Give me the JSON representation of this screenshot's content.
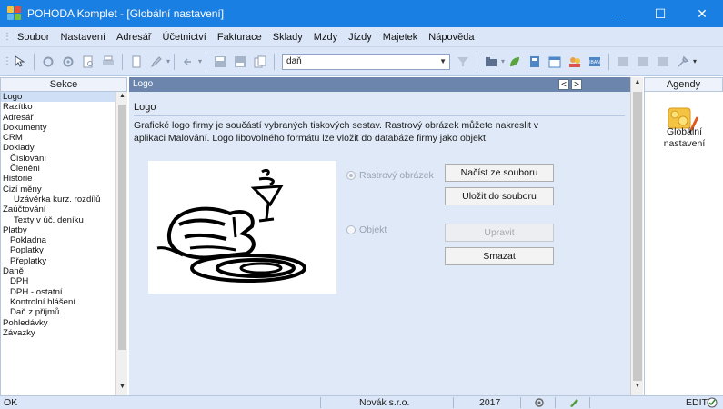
{
  "window": {
    "title": "POHODA Komplet - [Globální nastavení]",
    "minimize": "—",
    "maximize": "☐",
    "close": "✕"
  },
  "menu": {
    "items": [
      {
        "label": "Soubor"
      },
      {
        "label": "Nastavení"
      },
      {
        "label": "Adresář"
      },
      {
        "label": "Účetnictví"
      },
      {
        "label": "Fakturace"
      },
      {
        "label": "Sklady"
      },
      {
        "label": "Mzdy"
      },
      {
        "label": "Jízdy"
      },
      {
        "label": "Majetek"
      },
      {
        "label": "Nápověda"
      }
    ]
  },
  "toolbar": {
    "search_value": "daň"
  },
  "left_panel": {
    "header": "Sekce",
    "items": [
      {
        "label": "Logo",
        "level": 0,
        "selected": true
      },
      {
        "label": "Razítko",
        "level": 0
      },
      {
        "label": "Adresář",
        "level": 0
      },
      {
        "label": "Dokumenty",
        "level": 0
      },
      {
        "label": "CRM",
        "level": 0
      },
      {
        "label": "Doklady",
        "level": 0
      },
      {
        "label": "Číslování",
        "level": 1
      },
      {
        "label": "Členění",
        "level": 1
      },
      {
        "label": "Historie",
        "level": 0
      },
      {
        "label": "Cizí měny",
        "level": 0
      },
      {
        "label": "Uzávěrka kurz. rozdílů",
        "level": 1
      },
      {
        "label": "Zaúčtování",
        "level": 0
      },
      {
        "label": "Texty v úč. deníku",
        "level": 1
      },
      {
        "label": "Platby",
        "level": 0
      },
      {
        "label": "Pokladna",
        "level": 1
      },
      {
        "label": "Poplatky",
        "level": 1
      },
      {
        "label": "Přeplatky",
        "level": 1
      },
      {
        "label": "Daně",
        "level": 0
      },
      {
        "label": "DPH",
        "level": 1
      },
      {
        "label": "DPH - ostatní",
        "level": 1
      },
      {
        "label": "Kontrolní hlášení",
        "level": 1
      },
      {
        "label": "Daň z příjmů",
        "level": 1
      },
      {
        "label": "Pohledávky",
        "level": 0
      },
      {
        "label": "Závazky",
        "level": 0
      }
    ]
  },
  "main": {
    "header": "Logo",
    "nav_prev": "<",
    "nav_next": ">",
    "heading": "Logo",
    "description": "Grafické logo firmy je součástí vybraných tiskových sestav. Rastrový obrázek můžete nakreslit v aplikaci Malování. Logo libovolného formátu lze vložit do databáze firmy jako objekt.",
    "radio_raster": "Rastrový obrázek",
    "radio_object": "Objekt",
    "btn_load": "Načíst ze souboru",
    "btn_save": "Uložit do souboru",
    "btn_edit": "Upravit",
    "btn_delete": "Smazat"
  },
  "right_panel": {
    "header": "Agendy",
    "agenda_line1": "Globální",
    "agenda_line2": "nastavení"
  },
  "status": {
    "state": "OK",
    "company": "Novák s.r.o.",
    "year": "2017",
    "mode": "EDIT"
  },
  "colors": {
    "titlebar": "#1a7fe3",
    "chrome": "#dbe7f8",
    "panel_header": "#6b85ad",
    "content_bg": "#dfe9f7"
  }
}
